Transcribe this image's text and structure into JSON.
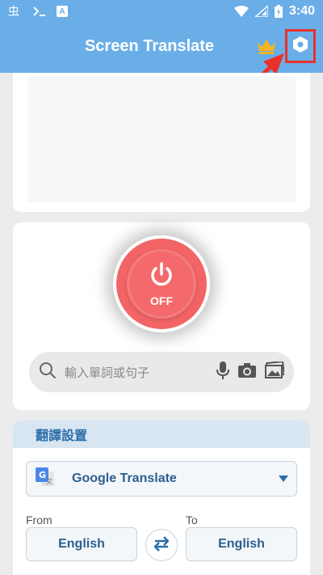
{
  "status_bar": {
    "time": "3:40",
    "icons": [
      "bug-icon",
      "terminal-icon",
      "text-a-icon",
      "wifi-icon",
      "signal-icon",
      "battery-charging-icon"
    ]
  },
  "app_bar": {
    "title": "Screen Translate",
    "crown_color": "#f5b41f",
    "highlight_color": "#e8312a"
  },
  "power": {
    "state_label": "OFF",
    "color": "#f26466"
  },
  "search": {
    "placeholder": "輸入單詞或句子"
  },
  "settings": {
    "title": "翻譯設置",
    "engine": "Google Translate",
    "from_label": "From",
    "to_label": "To",
    "from_language": "English",
    "to_language": "English"
  },
  "colors": {
    "primary": "#6aaee8",
    "accent_text": "#2b5f8f",
    "background": "#ececec"
  }
}
